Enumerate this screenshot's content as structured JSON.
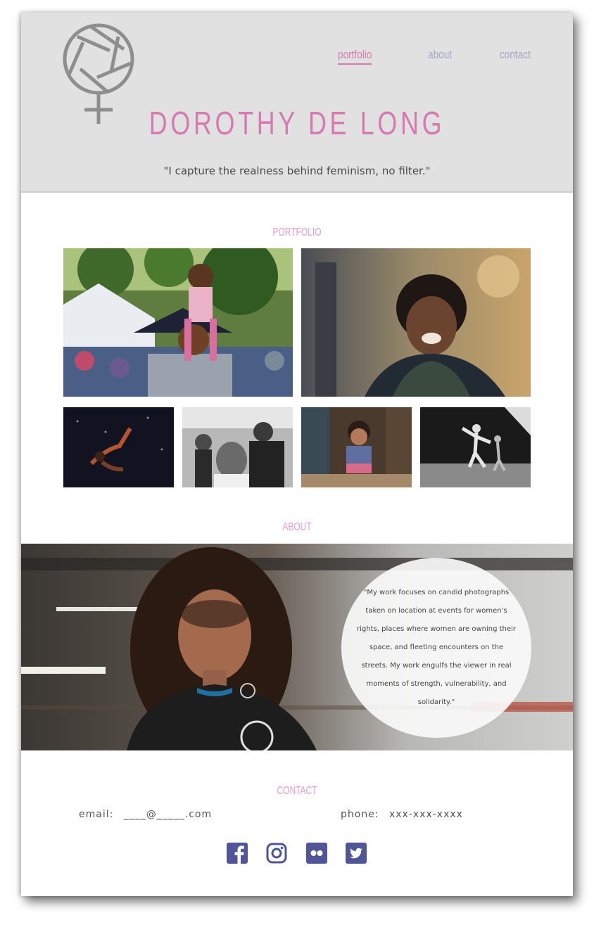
{
  "header": {
    "nav": [
      {
        "label": "portfolio",
        "active": true
      },
      {
        "label": "about",
        "active": false
      },
      {
        "label": "contact",
        "active": false
      }
    ],
    "title": "DOROTHY DE LONG",
    "tagline": "\"I capture the realness behind feminism, no filter.\""
  },
  "portfolio": {
    "heading": "PORTFOLIO"
  },
  "about": {
    "heading": "ABOUT",
    "quote": "\"My work focuses on candid photographs taken on location at events for women's rights, places where women are owning their space, and fleeting encounters on the streets. My work engulfs the viewer in real moments of strength, vulnerability, and solidarity.\""
  },
  "contact": {
    "heading": "CONTACT",
    "email_label": "email:",
    "email_value": "____@_____.com",
    "phone_label": "phone:",
    "phone_value": "xxx-xxx-xxxx"
  },
  "social": [
    {
      "icon": "facebook-icon"
    },
    {
      "icon": "instagram-icon"
    },
    {
      "icon": "flickr-icon"
    },
    {
      "icon": "twitter-icon"
    }
  ],
  "colors": {
    "accent_pink": "#d77ab1",
    "nav_inactive": "#a7a5c3",
    "social_icons": "#4f5596",
    "header_bg": "#e1e1e1"
  }
}
